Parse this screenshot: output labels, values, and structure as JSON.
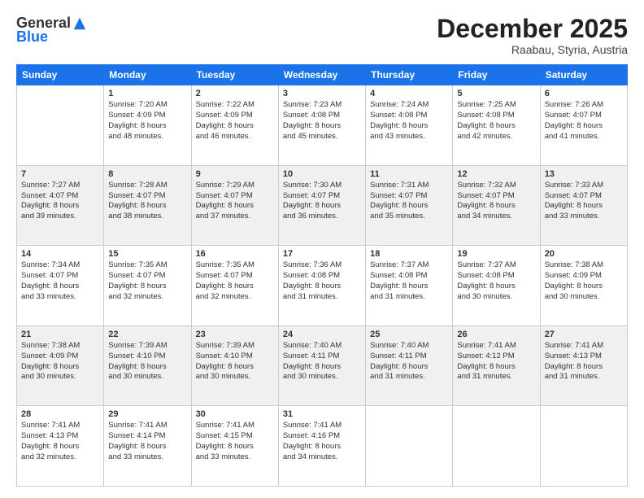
{
  "logo": {
    "general": "General",
    "blue": "Blue"
  },
  "header": {
    "month": "December 2025",
    "location": "Raabau, Styria, Austria"
  },
  "weekdays": [
    "Sunday",
    "Monday",
    "Tuesday",
    "Wednesday",
    "Thursday",
    "Friday",
    "Saturday"
  ],
  "weeks": [
    [
      {
        "day": "",
        "sunrise": "",
        "sunset": "",
        "daylight": ""
      },
      {
        "day": "1",
        "sunrise": "Sunrise: 7:20 AM",
        "sunset": "Sunset: 4:09 PM",
        "daylight": "Daylight: 8 hours and 48 minutes."
      },
      {
        "day": "2",
        "sunrise": "Sunrise: 7:22 AM",
        "sunset": "Sunset: 4:09 PM",
        "daylight": "Daylight: 8 hours and 46 minutes."
      },
      {
        "day": "3",
        "sunrise": "Sunrise: 7:23 AM",
        "sunset": "Sunset: 4:08 PM",
        "daylight": "Daylight: 8 hours and 45 minutes."
      },
      {
        "day": "4",
        "sunrise": "Sunrise: 7:24 AM",
        "sunset": "Sunset: 4:08 PM",
        "daylight": "Daylight: 8 hours and 43 minutes."
      },
      {
        "day": "5",
        "sunrise": "Sunrise: 7:25 AM",
        "sunset": "Sunset: 4:08 PM",
        "daylight": "Daylight: 8 hours and 42 minutes."
      },
      {
        "day": "6",
        "sunrise": "Sunrise: 7:26 AM",
        "sunset": "Sunset: 4:07 PM",
        "daylight": "Daylight: 8 hours and 41 minutes."
      }
    ],
    [
      {
        "day": "7",
        "sunrise": "Sunrise: 7:27 AM",
        "sunset": "Sunset: 4:07 PM",
        "daylight": "Daylight: 8 hours and 39 minutes."
      },
      {
        "day": "8",
        "sunrise": "Sunrise: 7:28 AM",
        "sunset": "Sunset: 4:07 PM",
        "daylight": "Daylight: 8 hours and 38 minutes."
      },
      {
        "day": "9",
        "sunrise": "Sunrise: 7:29 AM",
        "sunset": "Sunset: 4:07 PM",
        "daylight": "Daylight: 8 hours and 37 minutes."
      },
      {
        "day": "10",
        "sunrise": "Sunrise: 7:30 AM",
        "sunset": "Sunset: 4:07 PM",
        "daylight": "Daylight: 8 hours and 36 minutes."
      },
      {
        "day": "11",
        "sunrise": "Sunrise: 7:31 AM",
        "sunset": "Sunset: 4:07 PM",
        "daylight": "Daylight: 8 hours and 35 minutes."
      },
      {
        "day": "12",
        "sunrise": "Sunrise: 7:32 AM",
        "sunset": "Sunset: 4:07 PM",
        "daylight": "Daylight: 8 hours and 34 minutes."
      },
      {
        "day": "13",
        "sunrise": "Sunrise: 7:33 AM",
        "sunset": "Sunset: 4:07 PM",
        "daylight": "Daylight: 8 hours and 33 minutes."
      }
    ],
    [
      {
        "day": "14",
        "sunrise": "Sunrise: 7:34 AM",
        "sunset": "Sunset: 4:07 PM",
        "daylight": "Daylight: 8 hours and 33 minutes."
      },
      {
        "day": "15",
        "sunrise": "Sunrise: 7:35 AM",
        "sunset": "Sunset: 4:07 PM",
        "daylight": "Daylight: 8 hours and 32 minutes."
      },
      {
        "day": "16",
        "sunrise": "Sunrise: 7:35 AM",
        "sunset": "Sunset: 4:07 PM",
        "daylight": "Daylight: 8 hours and 32 minutes."
      },
      {
        "day": "17",
        "sunrise": "Sunrise: 7:36 AM",
        "sunset": "Sunset: 4:08 PM",
        "daylight": "Daylight: 8 hours and 31 minutes."
      },
      {
        "day": "18",
        "sunrise": "Sunrise: 7:37 AM",
        "sunset": "Sunset: 4:08 PM",
        "daylight": "Daylight: 8 hours and 31 minutes."
      },
      {
        "day": "19",
        "sunrise": "Sunrise: 7:37 AM",
        "sunset": "Sunset: 4:08 PM",
        "daylight": "Daylight: 8 hours and 30 minutes."
      },
      {
        "day": "20",
        "sunrise": "Sunrise: 7:38 AM",
        "sunset": "Sunset: 4:09 PM",
        "daylight": "Daylight: 8 hours and 30 minutes."
      }
    ],
    [
      {
        "day": "21",
        "sunrise": "Sunrise: 7:38 AM",
        "sunset": "Sunset: 4:09 PM",
        "daylight": "Daylight: 8 hours and 30 minutes."
      },
      {
        "day": "22",
        "sunrise": "Sunrise: 7:39 AM",
        "sunset": "Sunset: 4:10 PM",
        "daylight": "Daylight: 8 hours and 30 minutes."
      },
      {
        "day": "23",
        "sunrise": "Sunrise: 7:39 AM",
        "sunset": "Sunset: 4:10 PM",
        "daylight": "Daylight: 8 hours and 30 minutes."
      },
      {
        "day": "24",
        "sunrise": "Sunrise: 7:40 AM",
        "sunset": "Sunset: 4:11 PM",
        "daylight": "Daylight: 8 hours and 30 minutes."
      },
      {
        "day": "25",
        "sunrise": "Sunrise: 7:40 AM",
        "sunset": "Sunset: 4:11 PM",
        "daylight": "Daylight: 8 hours and 31 minutes."
      },
      {
        "day": "26",
        "sunrise": "Sunrise: 7:41 AM",
        "sunset": "Sunset: 4:12 PM",
        "daylight": "Daylight: 8 hours and 31 minutes."
      },
      {
        "day": "27",
        "sunrise": "Sunrise: 7:41 AM",
        "sunset": "Sunset: 4:13 PM",
        "daylight": "Daylight: 8 hours and 31 minutes."
      }
    ],
    [
      {
        "day": "28",
        "sunrise": "Sunrise: 7:41 AM",
        "sunset": "Sunset: 4:13 PM",
        "daylight": "Daylight: 8 hours and 32 minutes."
      },
      {
        "day": "29",
        "sunrise": "Sunrise: 7:41 AM",
        "sunset": "Sunset: 4:14 PM",
        "daylight": "Daylight: 8 hours and 33 minutes."
      },
      {
        "day": "30",
        "sunrise": "Sunrise: 7:41 AM",
        "sunset": "Sunset: 4:15 PM",
        "daylight": "Daylight: 8 hours and 33 minutes."
      },
      {
        "day": "31",
        "sunrise": "Sunrise: 7:41 AM",
        "sunset": "Sunset: 4:16 PM",
        "daylight": "Daylight: 8 hours and 34 minutes."
      },
      {
        "day": "",
        "sunrise": "",
        "sunset": "",
        "daylight": ""
      },
      {
        "day": "",
        "sunrise": "",
        "sunset": "",
        "daylight": ""
      },
      {
        "day": "",
        "sunrise": "",
        "sunset": "",
        "daylight": ""
      }
    ]
  ]
}
